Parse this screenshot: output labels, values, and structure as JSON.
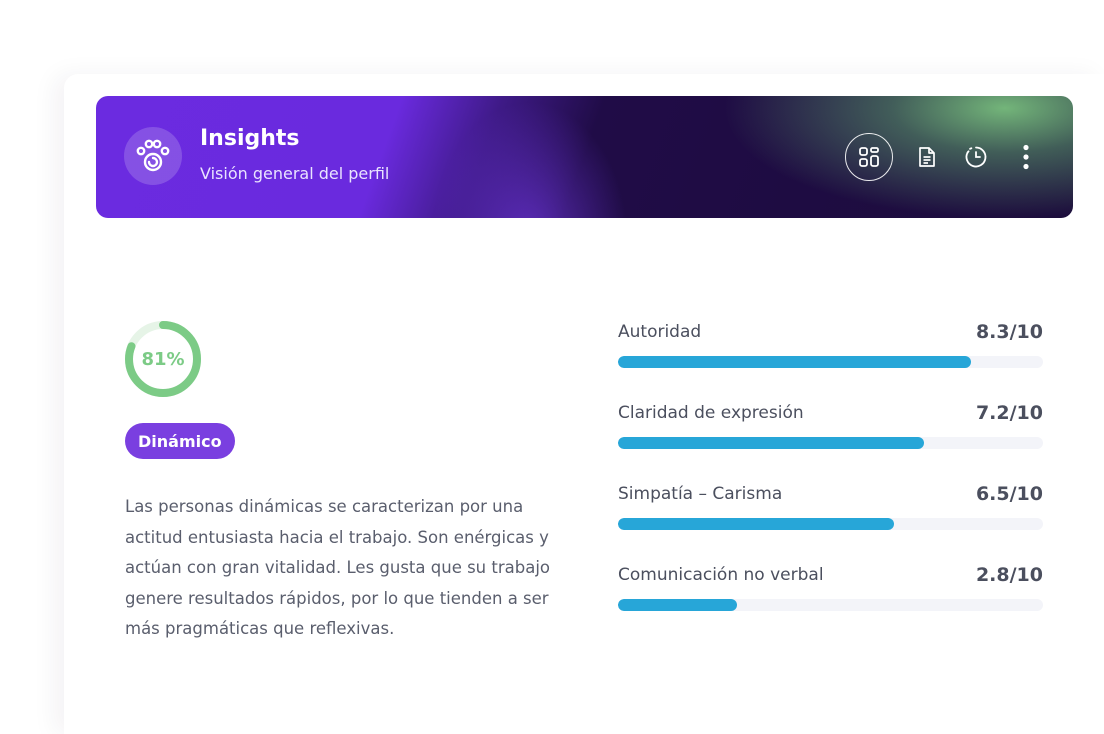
{
  "header": {
    "title": "Insights",
    "subtitle": "Visión general del perfil",
    "logo_icon": "paw-icon",
    "actions": [
      "grid-view-icon",
      "document-icon",
      "history-icon",
      "more-vertical-icon"
    ]
  },
  "profile": {
    "score": 0.81,
    "score_label": "81%",
    "type_badge": "Dinámico",
    "description": "Las personas dinámicas se caracterizan por una actitud entusiasta hacia el trabajo. Son enérgicas y actúan con gran vitalidad. Les gusta que su trabajo genere resultados rápidos, por lo que tienden a ser más pragmáticas que reflexivas."
  },
  "metrics": [
    {
      "label": "Autoridad",
      "value_text": "8.3/10",
      "value": 8.3,
      "max": 10
    },
    {
      "label": "Claridad de expresión",
      "value_text": "7.2/10",
      "value": 7.2,
      "max": 10
    },
    {
      "label": "Simpatía – Carisma",
      "value_text": "6.5/10",
      "value": 6.5,
      "max": 10
    },
    {
      "label": "Comunicación no verbal",
      "value_text": "2.8/10",
      "value": 2.8,
      "max": 10
    }
  ],
  "colors": {
    "accent_purple": "#7a3fe0",
    "bar_blue": "#27a6d8",
    "donut_green": "#7ccb86",
    "donut_track": "#e6f4e7"
  }
}
